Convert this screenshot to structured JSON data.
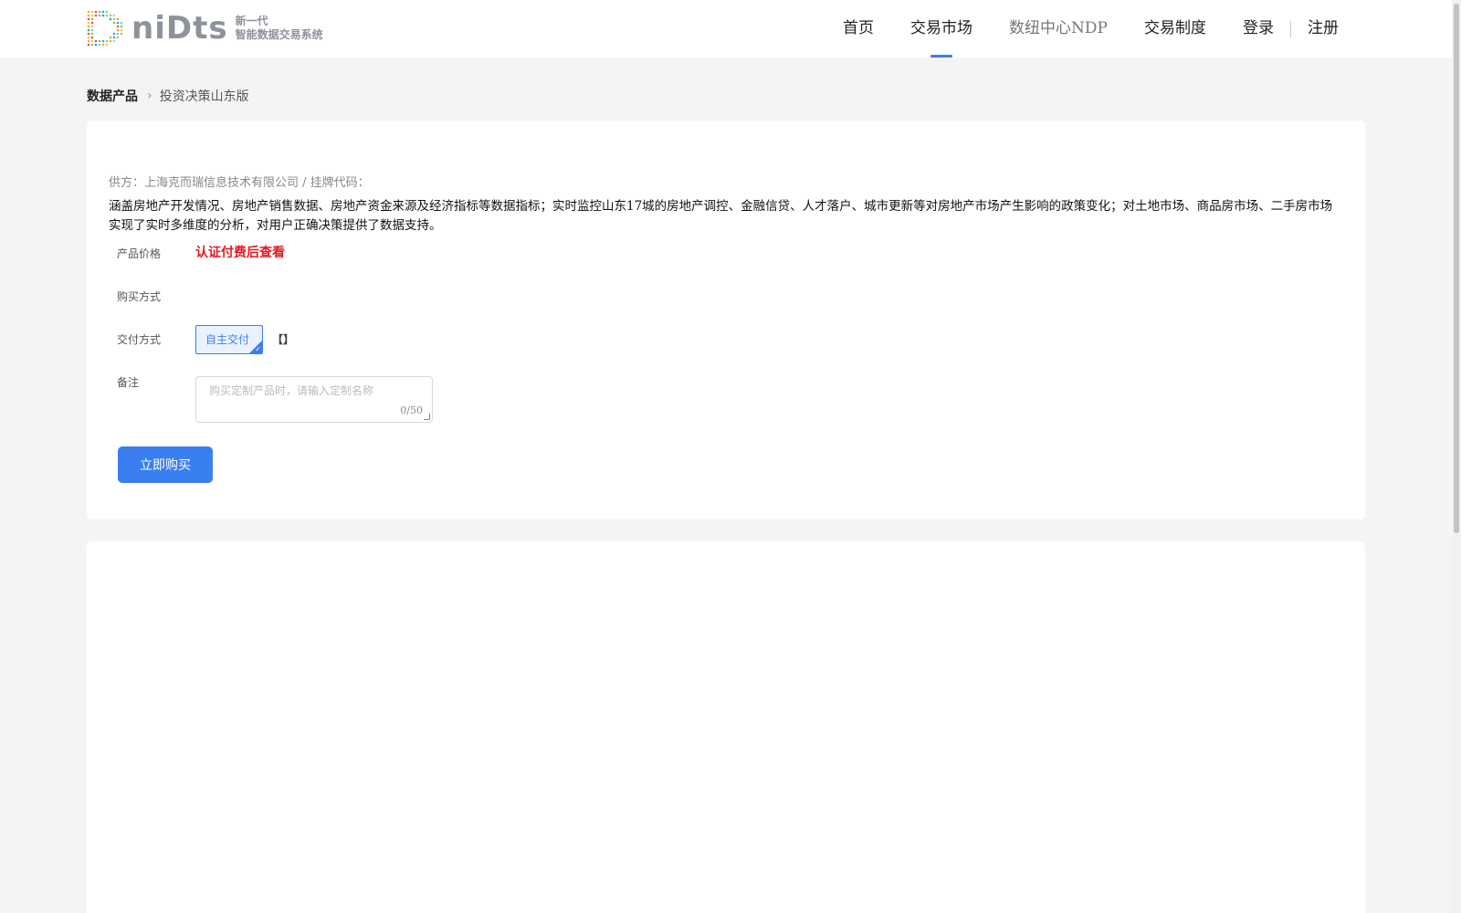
{
  "header": {
    "logo": {
      "wordmark": "niDts",
      "tagline_line1": "新一代",
      "tagline_line2": "智能数据交易系统"
    },
    "nav": [
      {
        "label": "首页",
        "active": false
      },
      {
        "label": "交易市场",
        "active": true
      },
      {
        "label": "数纽中心NDP",
        "active": false
      },
      {
        "label": "交易制度",
        "active": false
      }
    ],
    "login_label": "登录",
    "register_label": "注册"
  },
  "breadcrumb": {
    "root": "数据产品",
    "current": "投资决策山东版"
  },
  "product": {
    "supplier_line": "供方：上海克而瑞信息技术有限公司 / 挂牌代码：",
    "description": "涵盖房地产开发情况、房地产销售数据、房地产资金来源及经济指标等数据指标；实时监控山东17城的房地产调控、金融信贷、人才落户、城市更新等对房地产市场产生影响的政策变化；对土地市场、商品房市场、二手房市场实现了实时多维度的分析，对用户正确决策提供了数据支持。",
    "price_label": "产品价格",
    "price_value": "认证付费后查看",
    "purchase_method_label": "购买方式",
    "delivery_label": "交付方式",
    "delivery_option": "自主交付",
    "delivery_bracket": "【】",
    "remark_label": "备注",
    "remark_placeholder": "购买定制产品时，请输入定制名称",
    "remark_value": "",
    "remark_counter": "0/50",
    "buy_button": "立即购买"
  },
  "colors": {
    "accent": "#3a7ff0",
    "price_red": "#e8171e",
    "page_bg": "#f4f4f4"
  }
}
